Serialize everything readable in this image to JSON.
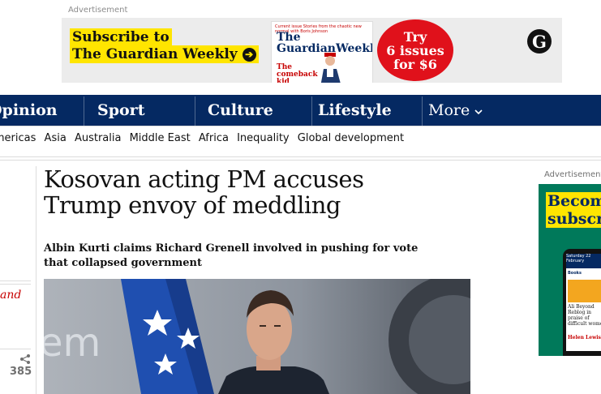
{
  "top_ad": {
    "label": "Advertisement",
    "subscribe_line1": "Subscribe to",
    "subscribe_line2": "The Guardian Weekly",
    "arrow": "➔",
    "magazine_tagline": "Current issue Stories from the chaotic new normal with Boris Johnson",
    "magazine_title_line1": "The",
    "magazine_title_line2": "GuardianWeekly",
    "magazine_cover_line1": "The",
    "magazine_cover_line2": "comeback",
    "magazine_cover_line3": "kid",
    "offer_line1": "Try",
    "offer_line2": "6 issues",
    "offer_line3": "for $6",
    "logo_glyph": "G"
  },
  "nav": {
    "items": [
      "Opinion",
      "Sport",
      "Culture",
      "Lifestyle"
    ],
    "more_label": "More",
    "more_icon": "chevron-down-icon",
    "background": "#052962"
  },
  "subnav": {
    "items": [
      "Americas",
      "Asia",
      "Australia",
      "Middle East",
      "Africa",
      "Inequality",
      "Global development"
    ]
  },
  "left_column": {
    "fragment_text": "and",
    "share_icon": "share-icon",
    "share_count": "385"
  },
  "article": {
    "headline": "Kosovan acting PM accuses Trump envoy of meddling",
    "standfirst": "Albin Kurti claims Richard Grenell involved in pushing for vote that collapsed government",
    "photo_backdrop_text": "em"
  },
  "right_ad": {
    "label": "Advertisement",
    "title_line1": "Becom",
    "title_line2": "subscr",
    "phone_header": "Saturday 22 February",
    "phone_section": "Books",
    "phone_headline": "Ali Beyond Reblog in praise of difficult women",
    "phone_byline": "Helen Lewis"
  },
  "colors": {
    "brand_blue": "#052962",
    "highlight_yellow": "#ffe500",
    "offer_red": "#e0111b",
    "accent_red": "#c70000"
  }
}
